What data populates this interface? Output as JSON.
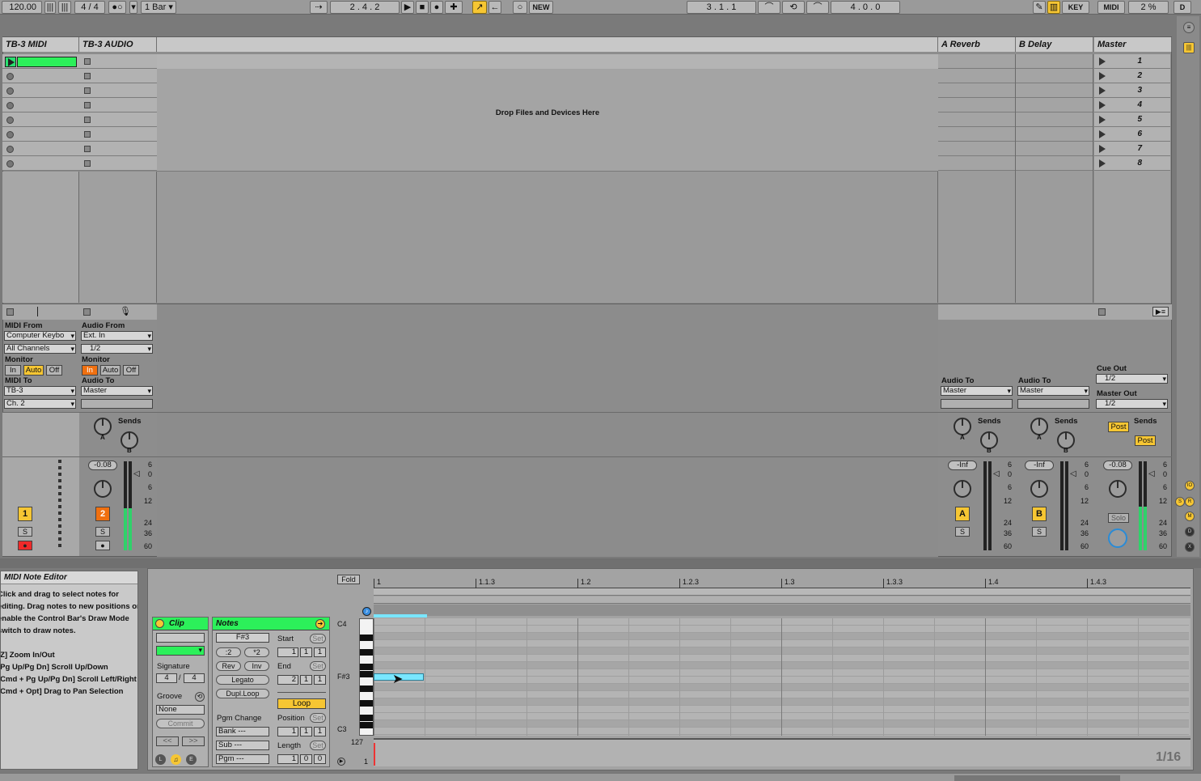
{
  "control_bar": {
    "tempo": "120.00",
    "signature": "4 / 4",
    "quantize": "1 Bar",
    "position": "2 .  4 .  2",
    "new_label": "NEW",
    "loop_start": "3 .  1 .  1",
    "loop_length": "4 .  0 .  0",
    "key_label": "KEY",
    "midi_label": "MIDI",
    "cpu": "2 %",
    "d_label": "D"
  },
  "tracks": [
    {
      "name": "TB-3 MIDI",
      "number": "1"
    },
    {
      "name": "TB-3 AUDIO",
      "number": "2"
    },
    {
      "name": "A Reverb",
      "number": "A"
    },
    {
      "name": "B Delay",
      "number": "B"
    },
    {
      "name": "Master"
    }
  ],
  "drop_text": "Drop Files and Devices Here",
  "scenes": [
    "1",
    "2",
    "3",
    "4",
    "5",
    "6",
    "7",
    "8"
  ],
  "io": {
    "midi_from_label": "MIDI From",
    "midi_from": "Computer Keybo",
    "midi_channel": "All Channels",
    "monitor_label": "Monitor",
    "in": "In",
    "auto": "Auto",
    "off": "Off",
    "midi_to_label": "MIDI To",
    "midi_to": "TB-3",
    "midi_to_ch": "Ch. 2",
    "audio_from_label": "Audio From",
    "audio_from": "Ext. In",
    "audio_from_ch": "1/2",
    "audio_to_label": "Audio To",
    "audio_to_master": "Master",
    "cue_out_label": "Cue Out",
    "cue_out": "1/2",
    "master_out_label": "Master Out",
    "master_out": "1/2",
    "sends_label": "Sends",
    "post": "Post"
  },
  "mixer": {
    "vol_audio": "-0.08",
    "vol_a": "-Inf",
    "vol_b": "-Inf",
    "vol_master": "-0.08",
    "solo_s": "S",
    "solo_label": "Solo",
    "knob_a": "A",
    "knob_b": "B",
    "scale": [
      "6",
      "0",
      "6",
      "12",
      "24",
      "36",
      "60"
    ]
  },
  "info": {
    "title": "MIDI Note Editor",
    "lines": [
      "Click and drag to select notes for",
      "editing. Drag notes to new positions or",
      "enable the Control Bar's Draw Mode",
      "switch to draw notes.",
      "",
      "[Z] Zoom In/Out",
      "[Pg Up/Pg Dn] Scroll Up/Down",
      "[Cmd + Pg Up/Pg Dn] Scroll Left/Right",
      "[Cmd + Opt] Drag to Pan Selection"
    ]
  },
  "clip": {
    "title": "Clip",
    "signature_label": "Signature",
    "sig_num": "4",
    "sig_den": "4",
    "groove_label": "Groove",
    "groove_value": "None",
    "commit": "Commit",
    "prev": "<<",
    "next": ">>",
    "l": "L",
    "e": "E"
  },
  "notes": {
    "title": "Notes",
    "pitch": "F#3",
    "div2": ":2",
    "mul2": "*2",
    "rev": "Rev",
    "inv": "Inv",
    "legato": "Legato",
    "dupl": "Dupl.Loop",
    "pgm_change_label": "Pgm Change",
    "bank": "Bank ---",
    "sub": "Sub ---",
    "pgm": "Pgm ---",
    "start_label": "Start",
    "set": "Set",
    "start": [
      "1",
      "1",
      "1"
    ],
    "end_label": "End",
    "end": [
      "2",
      "1",
      "1"
    ],
    "loop": "Loop",
    "position_label": "Position",
    "position": [
      "1",
      "1",
      "1"
    ],
    "length_label": "Length",
    "length": [
      "1",
      "0",
      "0"
    ]
  },
  "editor": {
    "fold": "Fold",
    "ruler": [
      "1",
      "1.1.3",
      "1.2",
      "1.2.3",
      "1.3",
      "1.3.3",
      "1.4",
      "1.4.3"
    ],
    "c4": "C4",
    "fs3": "F#3",
    "c3": "C3",
    "vel_max": "127",
    "vel_min": "1",
    "grid": "1/16"
  }
}
